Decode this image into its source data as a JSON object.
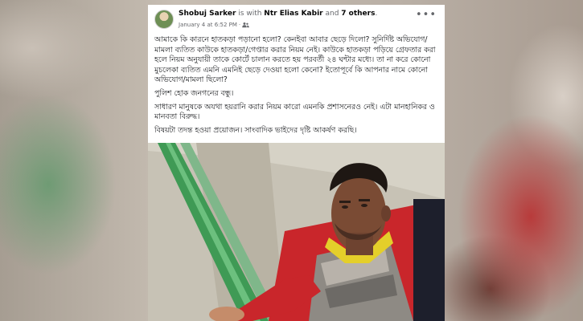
{
  "post": {
    "author": "Shobuj Sarker",
    "with_text": " is with ",
    "tagged_user": "Ntr Elias Kabir",
    "and_text": " and ",
    "others": "7 others",
    "period": ".",
    "timestamp": "January 4 at 6:52 PM",
    "dot": "·",
    "paragraphs": [
      "আমাকে কি কারনে  হাতকড়া পড়ানো হলো? কেনইবা আবার ছেড়ে দিলো? সুনির্দিষ্ট অভিযোগ/মামলা ব্যতিত কাউকে হাতকড়া/গেপ্তার করার নিয়ম নেই।  কাউকে হাতকড়া পড়িয়ে গ্রেফতার করা হলে নিয়ম অনুযায়ী তাকে কোর্টে চালান করতে হয় পরবর্তী ২৪ ঘন্টার মধ্যে। তা না করে কোনো মুচলেকা ব্যতিত এমনি এমনিই ছেড়ে দেওয়া হলো কেনো? ইতোপূর্বে কি আপনার নামে কোনো অভিযোগ/মামলা ছিলো?",
      "পুলিশ হোক জনগনের বন্ধু।",
      "সাধারণ মানুষকে অযথা হয়রানি করার নিয়ম কারো এমনকি প্রশাসনেরও নেই। এটা মানহানিকর ও মানবতা বিরুদ্ধ।",
      "বিষয়টা তদন্ত হওয়া প্রয়োজন। সাংবাদিক ভাইদের দৃষ্টি আকর্ষণ করছি।"
    ]
  },
  "icons": {
    "avatar": "profile-photo",
    "audience": "friends-icon",
    "more": "more-options-icon"
  },
  "colors": {
    "page_bg": "#ffffff",
    "name_text": "#050505",
    "meta_text": "#65676b"
  }
}
